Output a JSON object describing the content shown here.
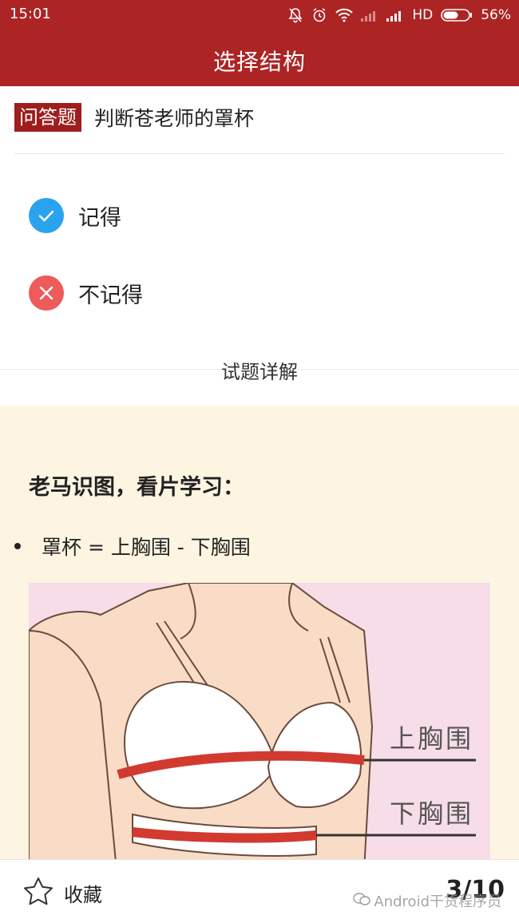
{
  "status_bar": {
    "time": "15:01",
    "network_label": "HD",
    "battery_percent": "56%"
  },
  "app_bar": {
    "title": "选择结构"
  },
  "question": {
    "type_badge": "问答题",
    "text": "判断苍老师的罩杯"
  },
  "options": [
    {
      "label": "记得",
      "icon": "check-circle-icon",
      "color": "#2aa3ef"
    },
    {
      "label": "不记得",
      "icon": "x-circle-icon",
      "color": "#ee5b5b"
    }
  ],
  "explanation": {
    "title": "试题详解",
    "heading": "老马识图，看片学习：",
    "bullets": [
      "罩杯 = 上胸围 - 下胸围"
    ],
    "diagram_labels": {
      "upper": "上胸围",
      "lower": "下胸围"
    }
  },
  "bottom_bar": {
    "favorite_label": "收藏",
    "page_counter": "3/10",
    "watermark": "Android干货程序员"
  },
  "colors": {
    "brand": "#ad2424",
    "badge": "#9e1e1e",
    "panel_bg": "#fdf5e1"
  }
}
